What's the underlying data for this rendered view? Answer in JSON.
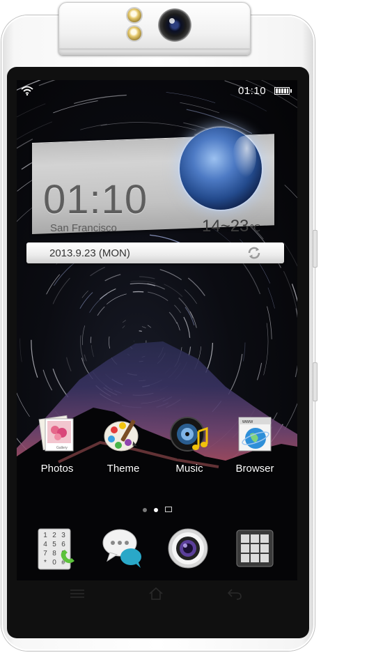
{
  "status_bar": {
    "time": "01:10",
    "wifi_icon": "wifi-icon",
    "battery_icon": "battery-full-icon"
  },
  "widget": {
    "time": "01:10",
    "city": "San Francisco",
    "temp": "14~23",
    "temp_unit": "℃",
    "date": "2013.9.23 (MON)",
    "refresh_icon": "refresh-icon",
    "weather_icon": "planet-icon"
  },
  "apps": [
    {
      "label": "Photos",
      "icon": "photos-icon",
      "tag": "Gallery"
    },
    {
      "label": "Theme",
      "icon": "palette-icon"
    },
    {
      "label": "Music",
      "icon": "music-icon"
    },
    {
      "label": "Browser",
      "icon": "globe-icon",
      "tag": "www"
    }
  ],
  "page_indicator": {
    "pages": 3,
    "current": 2
  },
  "dock": [
    {
      "icon": "dialer-icon",
      "keys": [
        "1",
        "2",
        "3",
        "4",
        "5",
        "6",
        "7",
        "8",
        "9",
        "*",
        "0",
        "#"
      ]
    },
    {
      "icon": "messages-icon"
    },
    {
      "icon": "camera-icon"
    },
    {
      "icon": "app-drawer-icon"
    }
  ],
  "nav": [
    {
      "icon": "menu-icon"
    },
    {
      "icon": "home-icon"
    },
    {
      "icon": "back-icon"
    }
  ],
  "colors": {
    "screen_bg": "#0b0c12",
    "widget_bg": "#c8c8c8",
    "accent_blue": "#4d7ac4"
  }
}
